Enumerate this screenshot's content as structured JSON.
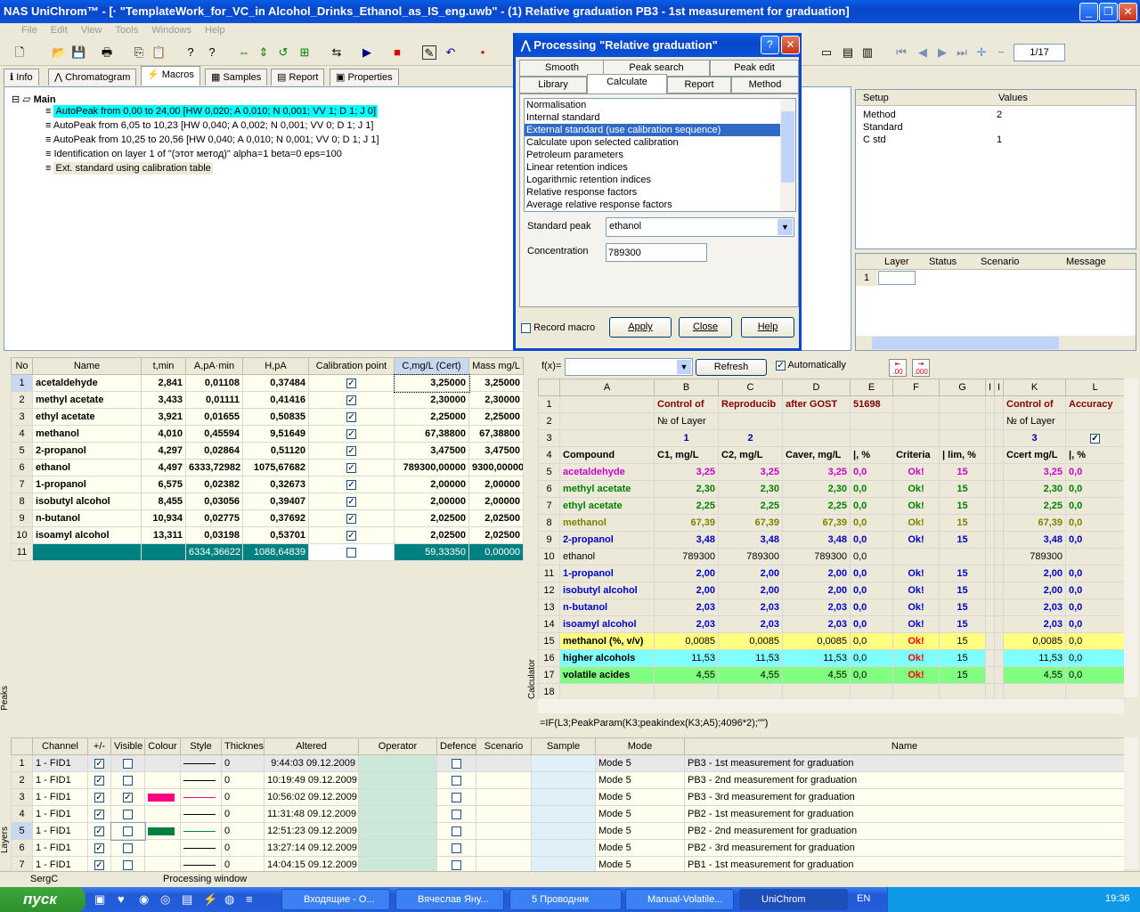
{
  "window": {
    "title": "NAS UniChrom™ - [· \"TemplateWork_for_VC_in Alcohol_Drinks_Ethanol_as_IS_eng.uwb\" - (1) Relative graduation PB3 - 1st measurement for graduation]"
  },
  "menu": [
    "File",
    "Edit",
    "View",
    "Tools",
    "Windows",
    "Help"
  ],
  "toolbar": {
    "page": "1/17"
  },
  "tabs": [
    "Info",
    "Chromatogram",
    "Macros",
    "Samples",
    "Report",
    "Properties"
  ],
  "macros": {
    "root": "Main",
    "items": [
      "AutoPeak from 0,00 to 24,00 [HW 0,020;  A 0,010;  N 0,001; VV 1;  D 1;  J 0]",
      "AutoPeak from 6,05 to 10,23 [HW 0,040;  A 0,002;  N 0,001; VV 0;  D 1;  J 1]",
      "AutoPeak from 10,25 to 20,56 [HW 0,040;  A 0,010;  N 0,001; VV 0;  D 1;  J 1]",
      "Identification on layer 1 of \"(этот метод)\" alpha=1 beta=0 eps=100",
      "Ext. standard using calibration table"
    ]
  },
  "setup": {
    "headers": [
      "Setup",
      "Values"
    ],
    "rows": [
      [
        "Method",
        "2"
      ],
      [
        "Standard",
        ""
      ],
      [
        "C std",
        "1"
      ]
    ],
    "msg_headers": [
      "Layer",
      "Status",
      "Scenario",
      "Message"
    ],
    "msg_row": "1"
  },
  "dialog": {
    "title": "Processing \"Relative graduation\"",
    "tabs_row1": [
      "Smooth",
      "Peak search",
      "Peak edit"
    ],
    "tabs_row2": [
      "Library",
      "Calculate",
      "Report",
      "Method"
    ],
    "list": [
      "Normalisation",
      "Internal standard",
      "External standard (use calibration sequence)",
      "Calculate upon selected calibration",
      "Petroleum parameters",
      "Linear retention indices",
      "Logarithmic retention indices",
      "Relative response factors",
      "Average relative response factors"
    ],
    "std_peak_label": "Standard peak",
    "std_peak_value": "ethanol",
    "conc_label": "Concentration",
    "conc_value": "789300",
    "record_macro": "Record macro",
    "apply": "Apply",
    "close": "Close",
    "help": "Help"
  },
  "peaks": {
    "headers": [
      "No",
      "Name",
      "t,min",
      "A,pA·min",
      "H,pA",
      "Calibration point",
      "C,mg/L (Cert)",
      "Mass mg/L"
    ],
    "rows": [
      [
        "1",
        "acetaldehyde",
        "2,841",
        "0,01108",
        "0,37484",
        "3,25000",
        "3,25000"
      ],
      [
        "2",
        "methyl acetate",
        "3,433",
        "0,01111",
        "0,41416",
        "2,30000",
        "2,30000"
      ],
      [
        "3",
        "ethyl acetate",
        "3,921",
        "0,01655",
        "0,50835",
        "2,25000",
        "2,25000"
      ],
      [
        "4",
        "methanol",
        "4,010",
        "0,45594",
        "9,51649",
        "67,38800",
        "67,38800"
      ],
      [
        "5",
        "2-propanol",
        "4,297",
        "0,02864",
        "0,51120",
        "3,47500",
        "3,47500"
      ],
      [
        "6",
        "ethanol",
        "4,497",
        "6333,72982",
        "1075,67682",
        "789300,00000",
        "9300,00000"
      ],
      [
        "7",
        "1-propanol",
        "6,575",
        "0,02382",
        "0,32673",
        "2,00000",
        "2,00000"
      ],
      [
        "8",
        "isobutyl alcohol",
        "8,455",
        "0,03056",
        "0,39407",
        "2,00000",
        "2,00000"
      ],
      [
        "9",
        "n-butanol",
        "10,934",
        "0,02775",
        "0,37692",
        "2,02500",
        "2,02500"
      ],
      [
        "10",
        "isoamyl alcohol",
        "13,311",
        "0,03198",
        "0,53701",
        "2,02500",
        "2,02500"
      ]
    ],
    "total": [
      "11",
      "",
      "",
      "6334,36622",
      "1088,64839",
      "59,33350",
      "0,00000"
    ],
    "side_label": "Peaks"
  },
  "calc": {
    "fx": "f(x)=",
    "refresh": "Refresh",
    "auto": "Automatically",
    "cols": [
      "A",
      "B",
      "C",
      "D",
      "E",
      "F",
      "G",
      "I",
      "I",
      "K",
      "L"
    ],
    "formula": "=IF(L3;PeakParam(K3;peakindex(K3;A5);4096*2);\"\")",
    "side_label": "Calculator",
    "r1": [
      "",
      "Control of",
      "Reproducib",
      "after GOST",
      "51698",
      "",
      "",
      "",
      "",
      "Control of",
      "Accuracy"
    ],
    "r2": [
      "",
      "№ of Layer",
      "",
      "",
      "",
      "",
      "",
      "",
      "",
      "№ of Layer",
      ""
    ],
    "r3": [
      "",
      "1",
      "2",
      "",
      "",
      "",
      "",
      "",
      "",
      "3",
      ""
    ],
    "r4": [
      "Compound",
      "C1, mg/L",
      "C2, mg/L",
      "Caver, mg/L",
      "|, %",
      "Criteria",
      "| lim, %",
      "",
      "",
      "Ccert mg/L",
      "|, %"
    ],
    "data": [
      [
        "5",
        "acetaldehyde",
        "3,25",
        "3,25",
        "3,25",
        "0,0",
        "Ok!",
        "15",
        "3,25",
        "0,0"
      ],
      [
        "6",
        "methyl acetate",
        "2,30",
        "2,30",
        "2,30",
        "0,0",
        "Ok!",
        "15",
        "2,30",
        "0,0"
      ],
      [
        "7",
        "ethyl acetate",
        "2,25",
        "2,25",
        "2,25",
        "0,0",
        "Ok!",
        "15",
        "2,25",
        "0,0"
      ],
      [
        "8",
        "methanol",
        "67,39",
        "67,39",
        "67,39",
        "0,0",
        "Ok!",
        "15",
        "67,39",
        "0,0"
      ],
      [
        "9",
        "2-propanol",
        "3,48",
        "3,48",
        "3,48",
        "0,0",
        "Ok!",
        "15",
        "3,48",
        "0,0"
      ],
      [
        "10",
        "ethanol",
        "789300",
        "789300",
        "789300",
        "0,0",
        "",
        "",
        "789300",
        ""
      ],
      [
        "11",
        "1-propanol",
        "2,00",
        "2,00",
        "2,00",
        "0,0",
        "Ok!",
        "15",
        "2,00",
        "0,0"
      ],
      [
        "12",
        "isobutyl alcohol",
        "2,00",
        "2,00",
        "2,00",
        "0,0",
        "Ok!",
        "15",
        "2,00",
        "0,0"
      ],
      [
        "13",
        "n-butanol",
        "2,03",
        "2,03",
        "2,03",
        "0,0",
        "Ok!",
        "15",
        "2,03",
        "0,0"
      ],
      [
        "14",
        "isoamyl alcohol",
        "2,03",
        "2,03",
        "2,03",
        "0,0",
        "Ok!",
        "15",
        "2,03",
        "0,0"
      ],
      [
        "15",
        "methanol (%, v/v)",
        "0,0085",
        "0,0085",
        "0,0085",
        "0,0",
        "Ok!",
        "15",
        "0,0085",
        "0,0"
      ],
      [
        "16",
        "higher alcohols",
        "11,53",
        "11,53",
        "11,53",
        "0,0",
        "Ok!",
        "15",
        "11,53",
        "0,0"
      ],
      [
        "17",
        "volatile acides",
        "4,55",
        "4,55",
        "4,55",
        "0,0",
        "Ok!",
        "15",
        "4,55",
        "0,0"
      ],
      [
        "18",
        "",
        "",
        "",
        "",
        "",
        "",
        "",
        "",
        ""
      ]
    ]
  },
  "layers": {
    "headers": [
      "Channel",
      "+/-",
      "Visible",
      "Colour",
      "Style",
      "Thickness",
      "Altered",
      "Operator",
      "Defence",
      "Scenario",
      "Sample",
      "Mode",
      "Name"
    ],
    "rows": [
      [
        "1",
        "1 - FID1",
        "0",
        "9:44:03 09.12.2009",
        "Mode 5",
        "PB3 - 1st measurement for graduation"
      ],
      [
        "2",
        "1 - FID1",
        "0",
        "10:19:49 09.12.2009",
        "Mode 5",
        "PB3 - 2nd measurement for graduation"
      ],
      [
        "3",
        "1 - FID1",
        "0",
        "10:56:02 09.12.2009",
        "Mode 5",
        "PB3 - 3rd measurement for graduation"
      ],
      [
        "4",
        "1 - FID1",
        "0",
        "11:31:48 09.12.2009",
        "Mode 5",
        "PB2 - 1st measurement for graduation"
      ],
      [
        "5",
        "1 - FID1",
        "0",
        "12:51:23 09.12.2009",
        "Mode 5",
        "PB2 - 2nd measurement for graduation"
      ],
      [
        "6",
        "1 - FID1",
        "0",
        "13:27:14 09.12.2009",
        "Mode 5",
        "PB2 - 3rd measurement for graduation"
      ],
      [
        "7",
        "1 - FID1",
        "0",
        "14:04:15 09.12.2009",
        "Mode 5",
        "PB1 - 1st measurement for graduation"
      ]
    ],
    "side_label": "Layers"
  },
  "status": {
    "user": "SergC",
    "text": "Processing window"
  },
  "taskbar": {
    "start": "пуск",
    "tasks": [
      "Входящие - О...",
      "Вячеслав Яну...",
      "5 Проводник",
      "Manual-Volatile...",
      "UniChrom"
    ],
    "lang": "EN",
    "clock": "19:36"
  },
  "colors": {
    "cyan": "#00ffff",
    "teal": "#008080",
    "yellow": "#ffff80",
    "lightcyan": "#80ffff",
    "green": "#80ff80",
    "magenta": "#cc00cc",
    "darkgreen": "#008000",
    "olive": "#808000",
    "blue": "#0000cc",
    "red": "#ff0000",
    "maroon": "#800000"
  }
}
